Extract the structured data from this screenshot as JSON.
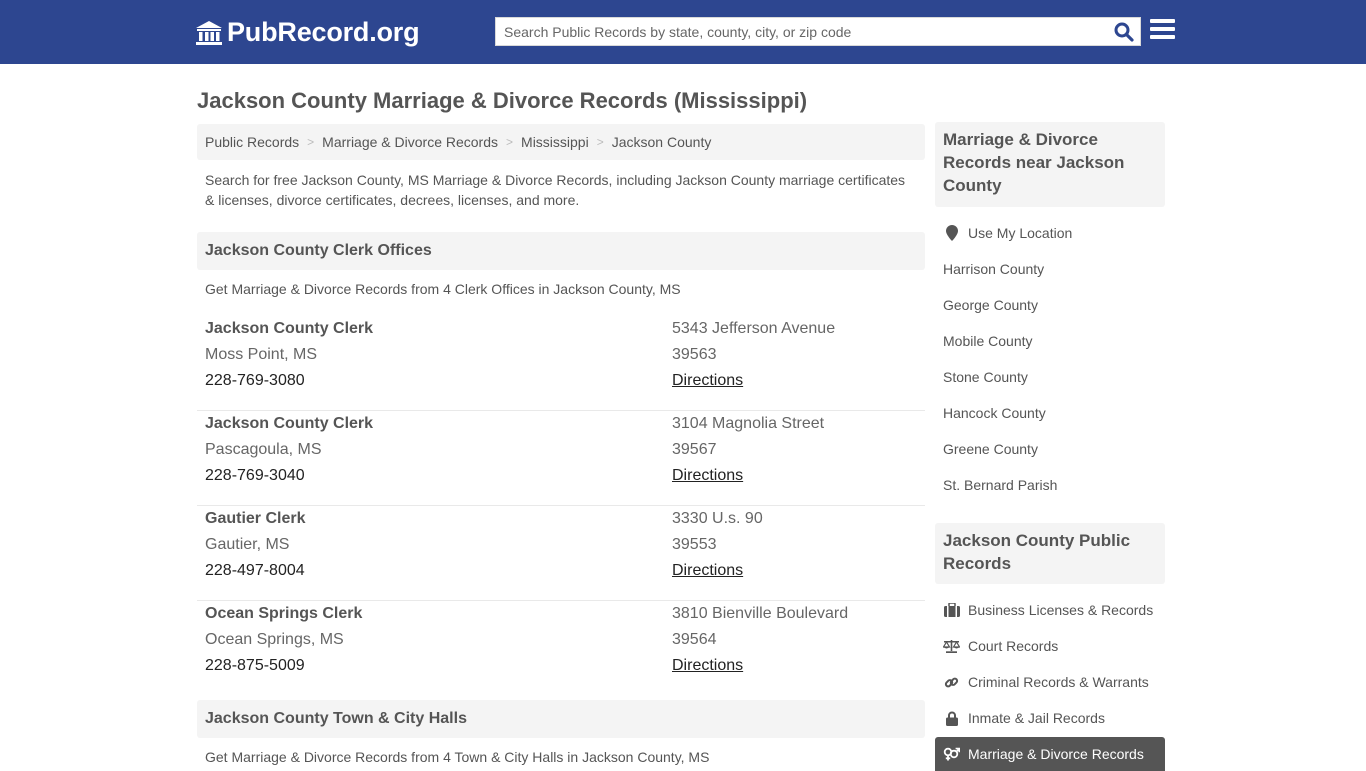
{
  "header": {
    "logo_text": "PubRecord.org",
    "search_placeholder": "Search Public Records by state, county, city, or zip code",
    "brand_color": "#2d4690"
  },
  "page": {
    "title": "Jackson County Marriage & Divorce Records (Mississippi)",
    "breadcrumb": [
      "Public Records",
      "Marriage & Divorce Records",
      "Mississippi",
      "Jackson County"
    ],
    "intro": "Search for free Jackson County, MS Marriage & Divorce Records, including Jackson County marriage certificates & licenses, divorce certificates, decrees, licenses, and more."
  },
  "clerk_section": {
    "heading": "Jackson County Clerk Offices",
    "subtitle": "Get Marriage & Divorce Records from 4 Clerk Offices in Jackson County, MS",
    "offices": [
      {
        "name": "Jackson County Clerk",
        "city": "Moss Point, MS",
        "phone": "228-769-3080",
        "address": "5343 Jefferson Avenue",
        "zip": "39563",
        "directions": "Directions"
      },
      {
        "name": "Jackson County Clerk",
        "city": "Pascagoula, MS",
        "phone": "228-769-3040",
        "address": "3104 Magnolia Street",
        "zip": "39567",
        "directions": "Directions"
      },
      {
        "name": "Gautier Clerk",
        "city": "Gautier, MS",
        "phone": "228-497-8004",
        "address": "3330 U.s. 90",
        "zip": "39553",
        "directions": "Directions"
      },
      {
        "name": "Ocean Springs Clerk",
        "city": "Ocean Springs, MS",
        "phone": "228-875-5009",
        "address": "3810 Bienville Boulevard",
        "zip": "39564",
        "directions": "Directions"
      }
    ]
  },
  "cityhall_section": {
    "heading": "Jackson County Town & City Halls",
    "subtitle": "Get Marriage & Divorce Records from 4 Town & City Halls in Jackson County, MS"
  },
  "sidebar": {
    "nearby_heading": "Marriage & Divorce Records near Jackson County",
    "use_location": "Use My Location",
    "nearby": [
      "Harrison County",
      "George County",
      "Mobile County",
      "Stone County",
      "Hancock County",
      "Greene County",
      "St. Bernard Parish"
    ],
    "public_heading": "Jackson County Public Records",
    "public_records": [
      {
        "label": "Business Licenses & Records",
        "icon": "briefcase-icon"
      },
      {
        "label": "Court Records",
        "icon": "scale-icon"
      },
      {
        "label": "Criminal Records & Warrants",
        "icon": "link-icon"
      },
      {
        "label": "Inmate & Jail Records",
        "icon": "lock-icon"
      },
      {
        "label": "Marriage & Divorce Records",
        "icon": "gender-icon",
        "active": true
      }
    ]
  }
}
